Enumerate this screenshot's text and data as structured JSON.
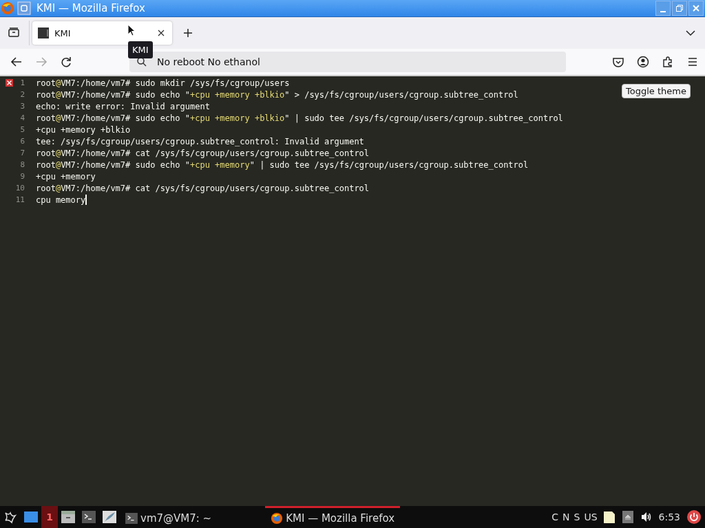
{
  "window": {
    "title": "KMI — Mozilla Firefox"
  },
  "tabs": [
    {
      "label": "KMI",
      "selected": true
    }
  ],
  "tooltip": "KMI",
  "address_bar": {
    "value": "No reboot No ethanol"
  },
  "page": {
    "toggle_button": "Toggle theme",
    "lines": [
      {
        "number": "1",
        "error": true,
        "cursor": false,
        "segments": [
          {
            "kind": "plain",
            "text": "root"
          },
          {
            "kind": "accent",
            "text": "@"
          },
          {
            "kind": "plain",
            "text": "VM7:/home/vm7# sudo mkdir /sys/fs/cgroup/users"
          }
        ]
      },
      {
        "number": "2",
        "error": false,
        "cursor": false,
        "segments": [
          {
            "kind": "plain",
            "text": "root"
          },
          {
            "kind": "accent",
            "text": "@"
          },
          {
            "kind": "plain",
            "text": "VM7:/home/vm7# sudo echo \""
          },
          {
            "kind": "accent",
            "text": "+cpu +memory +blkio"
          },
          {
            "kind": "plain",
            "text": "\" > /sys/fs/cgroup/users/cgroup.subtree_control"
          }
        ]
      },
      {
        "number": "3",
        "error": false,
        "cursor": false,
        "segments": [
          {
            "kind": "plain",
            "text": "echo: write error: Invalid argument"
          }
        ]
      },
      {
        "number": "4",
        "error": false,
        "cursor": false,
        "segments": [
          {
            "kind": "plain",
            "text": "root"
          },
          {
            "kind": "accent",
            "text": "@"
          },
          {
            "kind": "plain",
            "text": "VM7:/home/vm7# sudo echo \""
          },
          {
            "kind": "accent",
            "text": "+cpu +memory +blkio"
          },
          {
            "kind": "plain",
            "text": "\" | sudo tee /sys/fs/cgroup/users/cgroup.subtree_control"
          }
        ]
      },
      {
        "number": "5",
        "error": false,
        "cursor": false,
        "segments": [
          {
            "kind": "plain",
            "text": "+cpu +memory +blkio"
          }
        ]
      },
      {
        "number": "6",
        "error": false,
        "cursor": false,
        "segments": [
          {
            "kind": "plain",
            "text": "tee: /sys/fs/cgroup/users/cgroup.subtree_control: Invalid argument"
          }
        ]
      },
      {
        "number": "7",
        "error": false,
        "cursor": false,
        "segments": [
          {
            "kind": "plain",
            "text": "root"
          },
          {
            "kind": "accent",
            "text": "@"
          },
          {
            "kind": "plain",
            "text": "VM7:/home/vm7# cat /sys/fs/cgroup/users/cgroup.subtree_control"
          }
        ]
      },
      {
        "number": "8",
        "error": false,
        "cursor": false,
        "segments": [
          {
            "kind": "plain",
            "text": "root"
          },
          {
            "kind": "accent",
            "text": "@"
          },
          {
            "kind": "plain",
            "text": "VM7:/home/vm7# sudo echo \""
          },
          {
            "kind": "accent",
            "text": "+cpu +memory"
          },
          {
            "kind": "plain",
            "text": "\" | sudo tee /sys/fs/cgroup/users/cgroup.subtree_control"
          }
        ]
      },
      {
        "number": "9",
        "error": false,
        "cursor": false,
        "segments": [
          {
            "kind": "plain",
            "text": "+cpu +memory"
          }
        ]
      },
      {
        "number": "10",
        "error": false,
        "cursor": false,
        "segments": [
          {
            "kind": "plain",
            "text": "root"
          },
          {
            "kind": "accent",
            "text": "@"
          },
          {
            "kind": "plain",
            "text": "VM7:/home/vm7# cat /sys/fs/cgroup/users/cgroup.subtree_control"
          }
        ]
      },
      {
        "number": "11",
        "error": false,
        "cursor": true,
        "segments": [
          {
            "kind": "plain",
            "text": "cpu memory"
          }
        ]
      }
    ]
  },
  "taskbar": {
    "workspaces": [
      {
        "label": "1",
        "selected": true
      }
    ],
    "windows": [
      {
        "kind": "terminal",
        "label": "vm7@VM7: ~",
        "selected": false
      },
      {
        "kind": "browser",
        "label": "KMI — Mozilla Firefox",
        "selected": true
      }
    ],
    "indicators": [
      "C",
      "N",
      "S",
      "US"
    ],
    "clock": "6:53"
  }
}
